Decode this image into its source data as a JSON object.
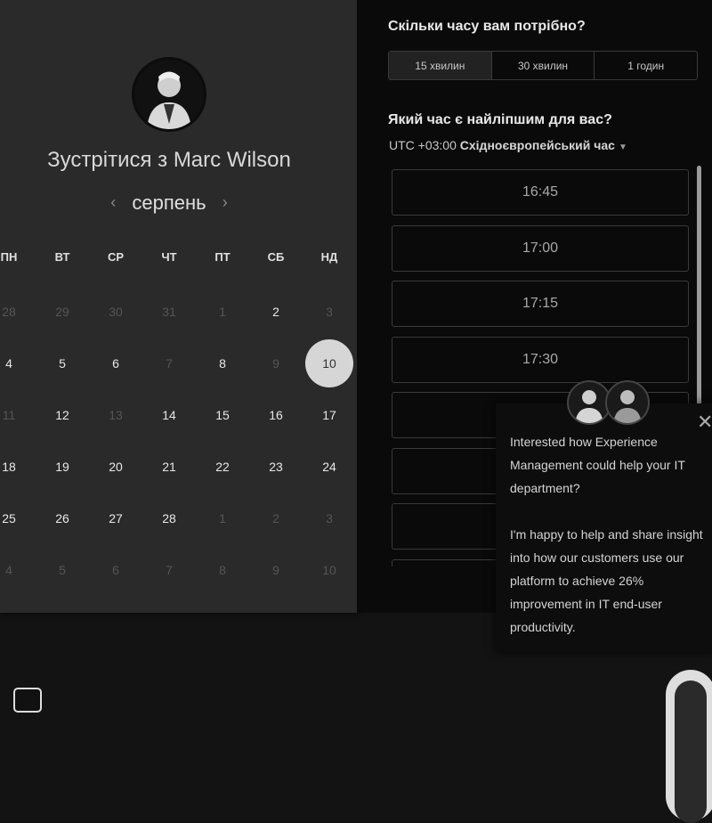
{
  "host": {
    "title_prefix": "Зустрітися з",
    "name": "Marc Wilson"
  },
  "calendar": {
    "month": "серпень",
    "prev_icon": "chevron-left-icon",
    "next_icon": "chevron-right-icon",
    "weekdays": [
      "ПН",
      "ВТ",
      "СР",
      "ЧТ",
      "ПТ",
      "СБ",
      "НД"
    ],
    "weeks": [
      [
        "28",
        "29",
        "30",
        "31",
        "1",
        "2",
        "3"
      ],
      [
        "4",
        "5",
        "6",
        "7",
        "8",
        "9",
        "10"
      ],
      [
        "11",
        "12",
        "13",
        "14",
        "15",
        "16",
        "17"
      ],
      [
        "18",
        "19",
        "20",
        "21",
        "22",
        "23",
        "24"
      ],
      [
        "25",
        "26",
        "27",
        "28",
        "1",
        "2",
        "3"
      ],
      [
        "4",
        "5",
        "6",
        "7",
        "8",
        "9",
        "10"
      ]
    ],
    "selected_day": "10"
  },
  "duration": {
    "question": "Скільки часу вам потрібно?",
    "options": [
      "15 хвилин",
      "30 хвилин",
      "1 годин"
    ],
    "selected": "15 хвилин"
  },
  "time_selection": {
    "question": "Який час є найліпшим для вас?",
    "timezone_offset": "UTC +03:00",
    "timezone_name": "Східноєвропейський час",
    "slots": [
      "16:45",
      "17:00",
      "17:15",
      "17:30",
      "",
      "",
      "",
      ""
    ]
  },
  "chat_popup": {
    "message_1": "Interested how Experience Management could help your IT department?",
    "message_2": "I'm happy to help and share insight into how our customers use our platform to achieve 26% improvement in IT end-user productivity.",
    "close_icon": "close-icon"
  },
  "colors": {
    "left_bg": "#2a2a2a",
    "right_bg": "#0a0a0a",
    "selected_day_bg": "#d6d6d6"
  }
}
